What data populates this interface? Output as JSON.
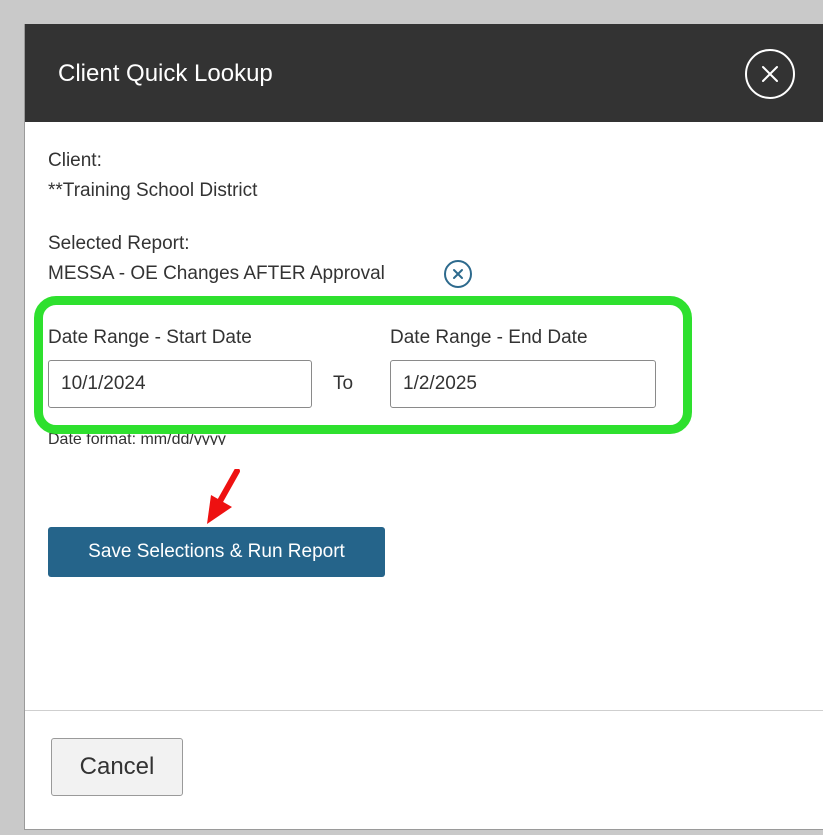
{
  "dialog": {
    "title": "Client Quick Lookup",
    "close_icon": "close-circle-icon"
  },
  "client": {
    "label": "Client:",
    "value": "**Training School District"
  },
  "report": {
    "label": "Selected Report:",
    "value": "MESSA - OE Changes AFTER Approval",
    "clear_icon": "clear-circle-icon"
  },
  "date_range": {
    "start_label": "Date Range - Start Date",
    "start_value": "10/1/2024",
    "separator": "To",
    "end_label": "Date Range - End Date",
    "end_value": "1/2/2025",
    "format_hint": "Date format: mm/dd/yyyy"
  },
  "actions": {
    "run_label": "Save Selections & Run Report",
    "cancel_label": "Cancel"
  },
  "colors": {
    "header_bg": "#333333",
    "primary_button": "#25648a",
    "highlight": "#2ee02e",
    "annotation_arrow": "#ee1111"
  }
}
